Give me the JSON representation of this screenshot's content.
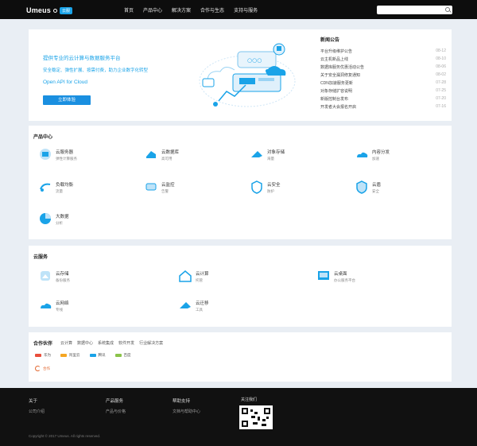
{
  "header": {
    "logo_text": "Umeus",
    "logo_badge": "云服",
    "nav": [
      "首页",
      "产品中心",
      "解决方案",
      "合作与生态",
      "支持与服务"
    ],
    "search_placeholder": ""
  },
  "banner": {
    "line1": "提供专业的云计算与数据服务平台",
    "line2": "安全稳定、弹性扩展、按需付费，助力企业数字化转型",
    "line3": "Open API for Cloud",
    "button": "立即体验"
  },
  "news": {
    "title": "新闻公告",
    "items": [
      {
        "text": "平台升级维护公告",
        "date": "08-12"
      },
      {
        "text": "云主机新品上线",
        "date": "08-10"
      },
      {
        "text": "数据库服务优惠活动公告",
        "date": "08-06"
      },
      {
        "text": "关于安全漏洞修复通知",
        "date": "08-02"
      },
      {
        "text": "CDN加速服务更新",
        "date": "07-28"
      },
      {
        "text": "对象存储扩容说明",
        "date": "07-25"
      },
      {
        "text": "新版控制台发布",
        "date": "07-20"
      },
      {
        "text": "开发者大会报名开启",
        "date": "07-16"
      }
    ]
  },
  "products": {
    "title": "产品中心",
    "items": [
      {
        "name": "云服务器",
        "sub": "弹性计算服务"
      },
      {
        "name": "云数据库",
        "sub": "高可用"
      },
      {
        "name": "对象存储",
        "sub": "海量"
      },
      {
        "name": "内容分发",
        "sub": "加速"
      },
      {
        "name": "负载均衡",
        "sub": "流量"
      },
      {
        "name": "云监控",
        "sub": "告警"
      },
      {
        "name": "云安全",
        "sub": "防护"
      },
      {
        "name": "云盾",
        "sub": "安全"
      },
      {
        "name": "大数据",
        "sub": "分析"
      }
    ]
  },
  "cloud": {
    "title": "云服务",
    "items": [
      {
        "name": "云存储",
        "sub": "备份服务"
      },
      {
        "name": "云计算",
        "sub": "托管"
      },
      {
        "name": "云桌面",
        "sub": "办公服务平台"
      },
      {
        "name": "云网络",
        "sub": "专线"
      },
      {
        "name": "云迁移",
        "sub": "工具"
      }
    ]
  },
  "partners": {
    "title": "合作伙伴",
    "links": [
      "云计算",
      "数据中心",
      "系统集成",
      "软件开发",
      "行业解决方案"
    ],
    "tags": [
      {
        "label": "华为",
        "color": "#e94e3c"
      },
      {
        "label": "阿里云",
        "color": "#f5a623"
      },
      {
        "label": "腾讯",
        "color": "#1aa3e8"
      },
      {
        "label": "百度",
        "color": "#8bc34a"
      }
    ],
    "logo_label": "合作"
  },
  "footer": {
    "cols": [
      {
        "head": "关于",
        "link": "公司介绍"
      },
      {
        "head": "产品服务",
        "link": "产品与价格"
      },
      {
        "head": "帮助支持",
        "link": "文档与帮助中心"
      }
    ],
    "qr_title": "关注我们",
    "copyright": "Copyright © 2017 Umeus. All rights reserved."
  },
  "colors": {
    "accent": "#1aa3e8",
    "topbar": "#0d0d0d",
    "footer": "#111111",
    "page": "#e9eef4"
  }
}
